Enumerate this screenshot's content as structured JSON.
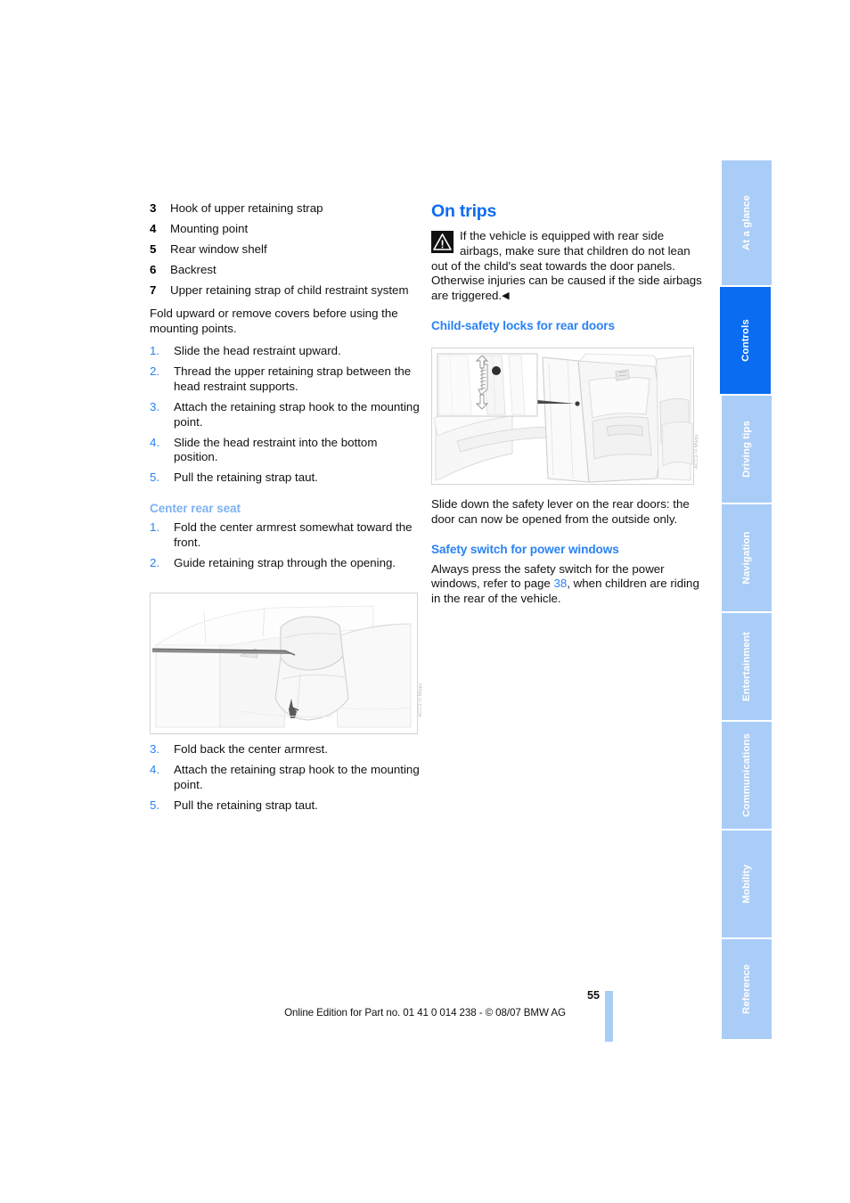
{
  "document": {
    "page_number": "55",
    "footer_text": "Online Edition for Part no. 01 41 0 014 238 - © 08/07 BMW AG"
  },
  "left_column": {
    "key_items": [
      {
        "num": "3",
        "text": "Hook of upper retaining strap"
      },
      {
        "num": "4",
        "text": "Mounting point"
      },
      {
        "num": "5",
        "text": "Rear window shelf"
      },
      {
        "num": "6",
        "text": "Backrest"
      },
      {
        "num": "7",
        "text": "Upper retaining strap of child restraint system"
      }
    ],
    "intro_paragraph": "Fold upward or remove covers before using the mounting points.",
    "steps_top": [
      {
        "num": "1.",
        "text": "Slide the head restraint upward."
      },
      {
        "num": "2.",
        "text": "Thread the upper retaining strap between the head restraint supports."
      },
      {
        "num": "3.",
        "text": "Attach the retaining strap hook to the mounting point."
      },
      {
        "num": "4.",
        "text": "Slide the head restraint into the bottom position."
      },
      {
        "num": "5.",
        "text": "Pull the retaining strap taut."
      }
    ],
    "center_rear_seat_heading": "Center rear seat",
    "steps_center_before": [
      {
        "num": "1.",
        "text": "Fold the center armrest somewhat toward the front."
      },
      {
        "num": "2.",
        "text": "Guide retaining strap through the opening."
      }
    ],
    "steps_center_after": [
      {
        "num": "3.",
        "text": "Fold back the center armrest."
      },
      {
        "num": "4.",
        "text": "Attach the retaining strap hook to the mounting point."
      },
      {
        "num": "5.",
        "text": "Pull the retaining strap taut."
      }
    ],
    "figure_armrest_code": "ACC2-V-Mwpy"
  },
  "right_column": {
    "title": "On trips",
    "warning_text": "If the vehicle is equipped with rear side airbags, make sure that children do not lean out of the child's seat towards the door panels. Otherwise injuries can be caused if the side airbags are triggered.",
    "warning_end_marker": "◀",
    "warning_icon": "warning-triangle-icon",
    "child_safety_heading": "Child-safety locks for rear doors",
    "child_safety_text": "Slide down the safety lever on the rear doors: the door can now be opened from the outside only.",
    "safety_switch_heading": "Safety switch for power windows",
    "safety_switch_text_before": "Always press the safety switch for the power windows, refer to page ",
    "safety_switch_page_ref": "38",
    "safety_switch_text_after": ", when children are riding in the rear of the vehicle.",
    "figure_door_code": "ACC2-V-Mwpy"
  },
  "tab_rail": {
    "tabs": [
      {
        "label": "At a glance",
        "active": false
      },
      {
        "label": "Controls",
        "active": true
      },
      {
        "label": "Driving tips",
        "active": false
      },
      {
        "label": "Navigation",
        "active": false
      },
      {
        "label": "Entertainment",
        "active": false
      },
      {
        "label": "Communications",
        "active": false
      },
      {
        "label": "Mobility",
        "active": false
      },
      {
        "label": "Reference",
        "active": false
      }
    ]
  },
  "colors": {
    "heading_blue": "#0a6cf0",
    "subheading_blue": "#2a82f2",
    "tab_inactive": "#aacdf7",
    "tab_active": "#0a6cf0",
    "list_number_blue": "#2a82f2"
  }
}
